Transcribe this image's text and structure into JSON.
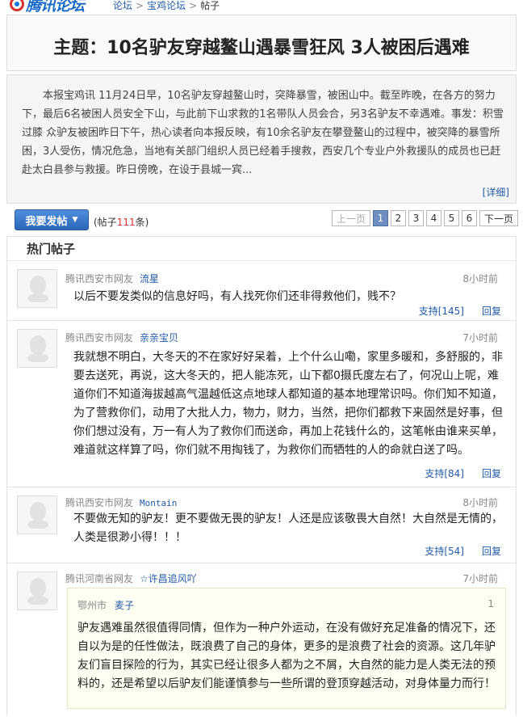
{
  "logo": {
    "brand": "腾讯论坛"
  },
  "breadcrumb": [
    "论坛",
    "宝鸡论坛",
    "帖子"
  ],
  "thread": {
    "title": "主题：10名驴友穿越鳌山遇暴雪狂风 3人被困后遇难",
    "summary": "本报宝鸡讯 11月24日早，10名驴友穿越鳌山时，突降暴雪，被困山中。截至昨晚，在各方的努力下，最后6名被困人员安全下山，与此前下山求救的1名带队人员会合，另3名驴友不幸遇难。事发：积雪过膝 众驴友被困昨日下午，热心读者向本报反映，有10余名驴友在攀登鳌山的过程中，被突降的暴雪所困，3人受伤，情况危急，当地有关部门组织人员已经着手搜救，西安几个专业户外救援队的成员也已赶赴太白县参与救援。昨日傍晚，在设于县城一宾...",
    "detail_link": "[详细]"
  },
  "toolbar": {
    "post_button": "我要发帖",
    "post_count_prefix": "(帖子",
    "post_count": "111",
    "post_count_suffix": "条)"
  },
  "pager": {
    "prev": "上一页",
    "pages": [
      "1",
      "2",
      "3",
      "4",
      "5",
      "6"
    ],
    "current": "1",
    "next": "下一页"
  },
  "hot": {
    "heading": "热门帖子",
    "posts": [
      {
        "source": "腾讯西安市网友",
        "user": "流星",
        "time": "8小时前",
        "body": "以后不要发类似的信息好吗，有人找死你们还非得救他们，贱不？",
        "support": "支持[145]",
        "reply": "回复"
      },
      {
        "source": "腾讯西安市网友",
        "user": "亲亲宝贝",
        "time": "7小时前",
        "body": "我就想不明白，大冬天的不在家好好呆着，上个什么山嘞，家里多暖和，多舒服的，非要去送死，再说，这大冬天的，把人能冻死，山下都0摄氏度左右了，何况山上呢，难道你们不知道海拔越高气温越低这点地球人都知道的基本地理常识吗。你们知不知道，为了营救你们，动用了大批人力，物力，财力，当然，把你们都救下来固然是好事，但你们想过没有，万一有人为了救你们而送命，再加上花钱什么的，这笔帐由谁来买单，难道就这样算了吗，你们就不用掏钱了，为救你们而牺牲的人的命就白送了吗。",
        "support": "支持[84]",
        "reply": "回复"
      },
      {
        "source": "腾讯西安市网友",
        "user": "Montain",
        "time": "8小时前",
        "body": "不要做无知的驴友！更不要做无畏的驴友！人还是应该敬畏大自然！大自然是无情的，人类是很渺小得！！！",
        "support": "支持[54]",
        "reply": "回复"
      },
      {
        "source": "腾讯河南省网友",
        "user": "☆许昌追风吖",
        "time": "7小时前",
        "quote": {
          "source": "鄂州市",
          "user": "麦子",
          "num": "1",
          "body": "驴友遇难虽然很值得同情，但作为一种户外运动，在没有做好充足准备的情况下，还自以为是的任性做法，既浪费了自己的身体，更多的是浪费了社会的资源。这几年驴友们盲目探险的行为，其实已经让很多人都为之不屑，大自然的能力是人类无法的预料的，还是希望以后驴友们能谨慎参与一些所谓的登顶穿越活动，对身体量力而行！"
        }
      }
    ]
  },
  "colors": {
    "link": "#1f5aa6",
    "accent_red": "#d9322c",
    "button_blue": "#2b66b8"
  }
}
